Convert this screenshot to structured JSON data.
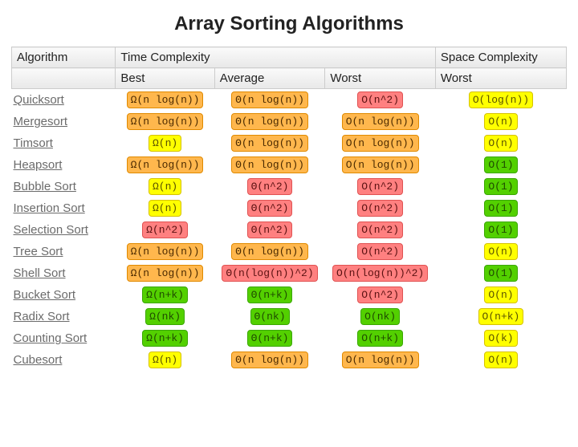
{
  "title": "Array Sorting Algorithms",
  "headers": {
    "algorithm": "Algorithm",
    "time": "Time Complexity",
    "space": "Space Complexity",
    "best": "Best",
    "average": "Average",
    "worst": "Worst"
  },
  "colors": {
    "green": "#53d000",
    "yellow": "#ffff00",
    "orange": "#ffb74d",
    "red": "#ff8080"
  },
  "rows": [
    {
      "name": "Quicksort",
      "best": {
        "v": "Ω(n log(n))",
        "c": "orange"
      },
      "average": {
        "v": "Θ(n log(n))",
        "c": "orange"
      },
      "worst": {
        "v": "O(n^2)",
        "c": "red"
      },
      "space": {
        "v": "O(log(n))",
        "c": "yellow"
      }
    },
    {
      "name": "Mergesort",
      "best": {
        "v": "Ω(n log(n))",
        "c": "orange"
      },
      "average": {
        "v": "Θ(n log(n))",
        "c": "orange"
      },
      "worst": {
        "v": "O(n log(n))",
        "c": "orange"
      },
      "space": {
        "v": "O(n)",
        "c": "yellow"
      }
    },
    {
      "name": "Timsort",
      "best": {
        "v": "Ω(n)",
        "c": "yellow"
      },
      "average": {
        "v": "Θ(n log(n))",
        "c": "orange"
      },
      "worst": {
        "v": "O(n log(n))",
        "c": "orange"
      },
      "space": {
        "v": "O(n)",
        "c": "yellow"
      }
    },
    {
      "name": "Heapsort",
      "best": {
        "v": "Ω(n log(n))",
        "c": "orange"
      },
      "average": {
        "v": "Θ(n log(n))",
        "c": "orange"
      },
      "worst": {
        "v": "O(n log(n))",
        "c": "orange"
      },
      "space": {
        "v": "O(1)",
        "c": "green"
      }
    },
    {
      "name": "Bubble Sort",
      "best": {
        "v": "Ω(n)",
        "c": "yellow"
      },
      "average": {
        "v": "Θ(n^2)",
        "c": "red"
      },
      "worst": {
        "v": "O(n^2)",
        "c": "red"
      },
      "space": {
        "v": "O(1)",
        "c": "green"
      }
    },
    {
      "name": "Insertion Sort",
      "best": {
        "v": "Ω(n)",
        "c": "yellow"
      },
      "average": {
        "v": "Θ(n^2)",
        "c": "red"
      },
      "worst": {
        "v": "O(n^2)",
        "c": "red"
      },
      "space": {
        "v": "O(1)",
        "c": "green"
      }
    },
    {
      "name": "Selection Sort",
      "best": {
        "v": "Ω(n^2)",
        "c": "red"
      },
      "average": {
        "v": "Θ(n^2)",
        "c": "red"
      },
      "worst": {
        "v": "O(n^2)",
        "c": "red"
      },
      "space": {
        "v": "O(1)",
        "c": "green"
      }
    },
    {
      "name": "Tree Sort",
      "best": {
        "v": "Ω(n log(n))",
        "c": "orange"
      },
      "average": {
        "v": "Θ(n log(n))",
        "c": "orange"
      },
      "worst": {
        "v": "O(n^2)",
        "c": "red"
      },
      "space": {
        "v": "O(n)",
        "c": "yellow"
      }
    },
    {
      "name": "Shell Sort",
      "best": {
        "v": "Ω(n log(n))",
        "c": "orange"
      },
      "average": {
        "v": "Θ(n(log(n))^2)",
        "c": "red"
      },
      "worst": {
        "v": "O(n(log(n))^2)",
        "c": "red"
      },
      "space": {
        "v": "O(1)",
        "c": "green"
      }
    },
    {
      "name": "Bucket Sort",
      "best": {
        "v": "Ω(n+k)",
        "c": "green"
      },
      "average": {
        "v": "Θ(n+k)",
        "c": "green"
      },
      "worst": {
        "v": "O(n^2)",
        "c": "red"
      },
      "space": {
        "v": "O(n)",
        "c": "yellow"
      }
    },
    {
      "name": "Radix Sort",
      "best": {
        "v": "Ω(nk)",
        "c": "green"
      },
      "average": {
        "v": "Θ(nk)",
        "c": "green"
      },
      "worst": {
        "v": "O(nk)",
        "c": "green"
      },
      "space": {
        "v": "O(n+k)",
        "c": "yellow"
      }
    },
    {
      "name": "Counting Sort",
      "best": {
        "v": "Ω(n+k)",
        "c": "green"
      },
      "average": {
        "v": "Θ(n+k)",
        "c": "green"
      },
      "worst": {
        "v": "O(n+k)",
        "c": "green"
      },
      "space": {
        "v": "O(k)",
        "c": "yellow"
      }
    },
    {
      "name": "Cubesort",
      "best": {
        "v": "Ω(n)",
        "c": "yellow"
      },
      "average": {
        "v": "Θ(n log(n))",
        "c": "orange"
      },
      "worst": {
        "v": "O(n log(n))",
        "c": "orange"
      },
      "space": {
        "v": "O(n)",
        "c": "yellow"
      }
    }
  ]
}
